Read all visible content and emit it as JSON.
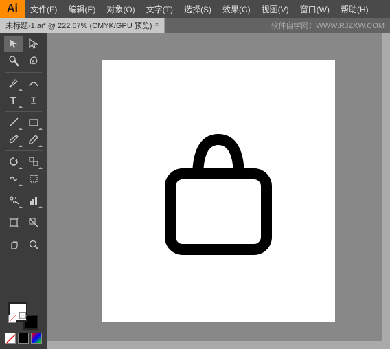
{
  "titleBar": {
    "logo": "Ai",
    "menus": [
      "文件(F)",
      "编辑(E)",
      "对象(O)",
      "文字(T)",
      "选择(S)",
      "效果(C)",
      "视图(V)",
      "窗口(W)",
      "帮助(H)"
    ]
  },
  "tabBar": {
    "tab": {
      "label": "未标题-1.ai* @ 222.67%  (CMYK/GPU 预览)",
      "close": "×"
    },
    "watermark": "软件自学网：WWW.RJZXW.COM"
  },
  "toolbar": {
    "tools": [
      {
        "id": "select",
        "icon": "▶",
        "sub": true
      },
      {
        "id": "direct-select",
        "icon": "↖",
        "sub": true
      },
      {
        "id": "magic-wand",
        "icon": "✦",
        "sub": true
      },
      {
        "id": "lasso",
        "icon": "⌒",
        "sub": true
      },
      {
        "id": "pen",
        "icon": "✒",
        "sub": true
      },
      {
        "id": "type",
        "icon": "T",
        "sub": true
      },
      {
        "id": "line",
        "icon": "╲",
        "sub": true
      },
      {
        "id": "rect",
        "icon": "□",
        "sub": true
      },
      {
        "id": "paintbrush",
        "icon": "✏",
        "sub": true
      },
      {
        "id": "rotate",
        "icon": "↺",
        "sub": true
      },
      {
        "id": "transform",
        "icon": "⤢",
        "sub": true
      },
      {
        "id": "symbol",
        "icon": "❋",
        "sub": true
      },
      {
        "id": "graph",
        "icon": "▦",
        "sub": true
      },
      {
        "id": "artboard",
        "icon": "⬚",
        "sub": true
      },
      {
        "id": "hand",
        "icon": "✋",
        "sub": false
      },
      {
        "id": "zoom",
        "icon": "🔍",
        "sub": false
      }
    ]
  }
}
